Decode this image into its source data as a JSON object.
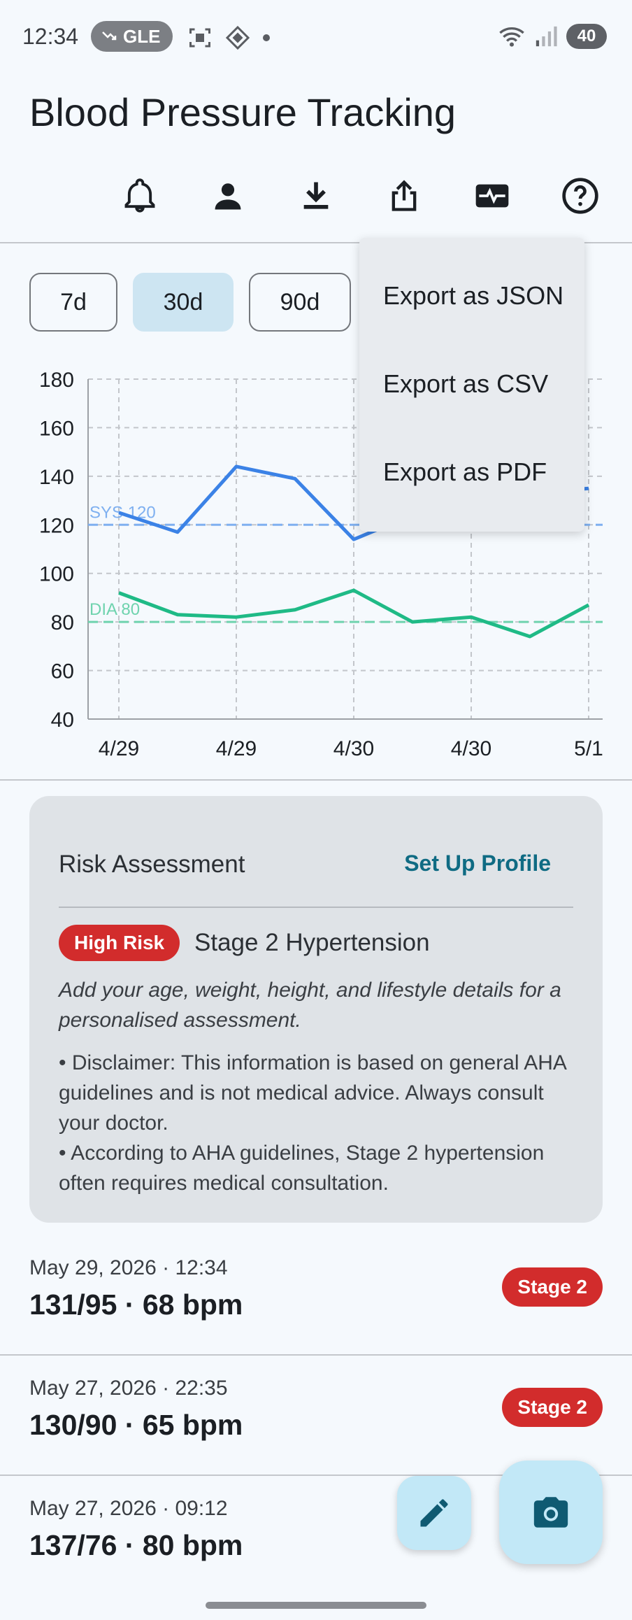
{
  "status_bar": {
    "time": "12:34",
    "pill_text": "GLE",
    "battery": "40"
  },
  "app": {
    "title": "Blood Pressure Tracking"
  },
  "toolbar": {
    "icons": [
      "bell-icon",
      "person-icon",
      "download-icon",
      "share-icon",
      "heart-monitor-icon",
      "help-icon"
    ]
  },
  "range_chips": [
    {
      "label": "7d",
      "active": false
    },
    {
      "label": "30d",
      "active": true
    },
    {
      "label": "90d",
      "active": false
    }
  ],
  "export_menu": {
    "items": [
      "Export as JSON",
      "Export as CSV",
      "Export as PDF"
    ]
  },
  "chart_data": {
    "type": "line",
    "x_tick_labels": [
      "4/29",
      "4/29",
      "4/30",
      "4/30",
      "5/1"
    ],
    "ylim": [
      40,
      180
    ],
    "y_ticks": [
      40,
      60,
      80,
      100,
      120,
      140,
      160,
      180
    ],
    "grid": true,
    "series": [
      {
        "key": "sys",
        "color": "#3b82e6",
        "values": [
          125,
          117,
          144,
          139,
          114,
          124,
          131,
          133,
          135
        ]
      },
      {
        "key": "dia",
        "color": "#1fba86",
        "values": [
          92,
          83,
          82,
          85,
          93,
          80,
          82,
          74,
          87
        ]
      }
    ],
    "reference_lines": [
      {
        "label": "SYS 120",
        "value": 120,
        "color": "#7fb0f0"
      },
      {
        "label": "DIA 80",
        "value": 80,
        "color": "#6fd3ae"
      }
    ]
  },
  "risk": {
    "title": "Risk Assessment",
    "setup_link": "Set Up Profile",
    "badge": "High Risk",
    "stage": "Stage 2 Hypertension",
    "note": "Add your age, weight, height, and lifestyle details for a personalised assessment.",
    "bullets": [
      "• Disclaimer: This information is based on general AHA guidelines and is not medical advice. Always consult your doctor.",
      "• According to AHA guidelines, Stage 2 hypertension often requires medical consultation."
    ]
  },
  "readings": [
    {
      "date": "May 29, 2026 · 12:34",
      "value": "131/95 · 68 bpm",
      "badge": "Stage 2"
    },
    {
      "date": "May 27, 2026 · 22:35",
      "value": "130/90 · 65 bpm",
      "badge": "Stage 2"
    },
    {
      "date": "May 27, 2026 · 09:12",
      "value": "137/76 · 80 bpm",
      "badge": ""
    }
  ],
  "colors": {
    "accent": "#0f6b83",
    "danger": "#d22c2c",
    "fab": "#c2e8f7"
  }
}
